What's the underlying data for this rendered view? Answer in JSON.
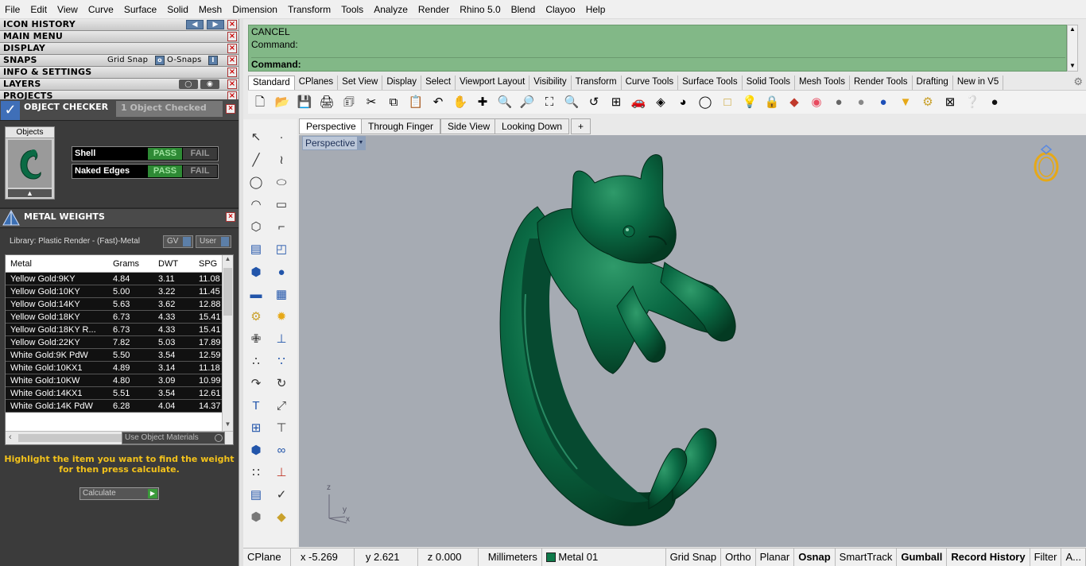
{
  "menu": [
    "File",
    "Edit",
    "View",
    "Curve",
    "Surface",
    "Solid",
    "Mesh",
    "Dimension",
    "Transform",
    "Tools",
    "Analyze",
    "Render",
    "Rhino 5.0",
    "Blend",
    "Clayoo",
    "Help"
  ],
  "panel": {
    "sections": {
      "icon_history": "ICON HISTORY",
      "main_menu": "MAIN MENU",
      "display": "DISPLAY",
      "snaps": "SNAPS",
      "info": "INFO & SETTINGS",
      "layers": "LAYERS",
      "projects": "PROJECTS"
    },
    "snaps_grid": "Grid Snap",
    "snaps_osnaps": "O-Snaps",
    "object_checker": {
      "title": "OBJECT CHECKER",
      "status": "1  Object Checked",
      "objects_label": "Objects",
      "rows": [
        {
          "name": "Shell",
          "pass": "PASS",
          "fail": "FAIL"
        },
        {
          "name": "Naked Edges",
          "pass": "PASS",
          "fail": "FAIL"
        }
      ]
    },
    "metal_weights": {
      "title": "METAL WEIGHTS",
      "library": "Library: Plastic Render - (Fast)-Metal",
      "gv_label": "GV",
      "user_label": "User",
      "columns": [
        "Metal",
        "Grams",
        "DWT",
        "SPG"
      ],
      "rows": [
        [
          "Yellow Gold:9KY",
          "4.84",
          "3.11",
          "11.08"
        ],
        [
          "Yellow Gold:10KY",
          "5.00",
          "3.22",
          "11.45"
        ],
        [
          "Yellow Gold:14KY",
          "5.63",
          "3.62",
          "12.88"
        ],
        [
          "Yellow Gold:18KY",
          "6.73",
          "4.33",
          "15.41"
        ],
        [
          "Yellow Gold:18KY R...",
          "6.73",
          "4.33",
          "15.41"
        ],
        [
          "Yellow Gold:22KY",
          "7.82",
          "5.03",
          "17.89"
        ],
        [
          "White Gold:9K PdW",
          "5.50",
          "3.54",
          "12.59"
        ],
        [
          "White Gold:10KX1",
          "4.89",
          "3.14",
          "11.18"
        ],
        [
          "White Gold:10KW",
          "4.80",
          "3.09",
          "10.99"
        ],
        [
          "White Gold:14KX1",
          "5.51",
          "3.54",
          "12.61"
        ],
        [
          "White Gold:14K PdW",
          "6.28",
          "4.04",
          "14.37"
        ]
      ],
      "use_object_materials": "Use Object Materials",
      "hint_line1": "Highlight the item you want to find the weight",
      "hint_line2": "for then press calculate.",
      "calculate": "Calculate"
    }
  },
  "command": {
    "line1": "CANCEL",
    "line2": "Command:",
    "line3": "Command:"
  },
  "tool_tabs": [
    "Standard",
    "CPlanes",
    "Set View",
    "Display",
    "Select",
    "Viewport Layout",
    "Visibility",
    "Transform",
    "Curve Tools",
    "Surface Tools",
    "Solid Tools",
    "Mesh Tools",
    "Render Tools",
    "Drafting",
    "New in V5"
  ],
  "viewport_tabs": [
    "Perspective",
    "Through Finger",
    "Side View",
    "Looking Down",
    "+"
  ],
  "viewport_label": "Perspective",
  "axes": {
    "z": "z",
    "y": "y",
    "x": "x"
  },
  "status": {
    "cplane": "CPlane",
    "x": "x -5.269",
    "y": "y 2.621",
    "z": "z 0.000",
    "units": "Millimeters",
    "layer": "Metal 01",
    "grid_snap": "Grid Snap",
    "ortho": "Ortho",
    "planar": "Planar",
    "osnap": "Osnap",
    "smarttrack": "SmartTrack",
    "gumball": "Gumball",
    "record_history": "Record History",
    "filter": "Filter",
    "more": "A..."
  },
  "colors": {
    "model_green": "#0b6b45",
    "command_bg": "#82b887",
    "layer_swatch": "#0e7a4a"
  }
}
